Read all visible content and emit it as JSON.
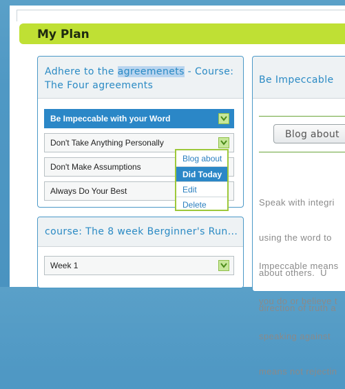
{
  "plan": {
    "title": "My Plan"
  },
  "goal1": {
    "title_part1": "Adhere to the ",
    "title_highlight": "agreemenets",
    "title_part2": " - Course:",
    "title_line2": "The Four agreements",
    "steps": [
      {
        "label": "Be Impeccable with your Word",
        "active": true
      },
      {
        "label": "Don't Take Anything Personally"
      },
      {
        "label": "Don't Make Assumptions"
      },
      {
        "label": "Always Do Your Best"
      }
    ]
  },
  "menu": {
    "items": [
      "Blog about",
      "Did Today",
      "Edit",
      "Delete"
    ],
    "selected": "Did Today"
  },
  "goal2": {
    "title": "course: The 8 week Berginner's Run...",
    "steps": [
      {
        "label": "Week 1"
      }
    ]
  },
  "detail": {
    "title": "Be Impeccable",
    "blog_button": "Blog about",
    "para1": [
      "Speak with integri",
      "using the word to",
      "about others.  U",
      "direction of truth a"
    ],
    "para2": [
      "Impeccable means",
      "you do or believe t",
      "speaking against",
      "means not rejectin"
    ]
  },
  "colors": {
    "accent_green": "#bfe034",
    "accent_blue": "#2b87c7",
    "link_blue": "#2a8ac4"
  }
}
